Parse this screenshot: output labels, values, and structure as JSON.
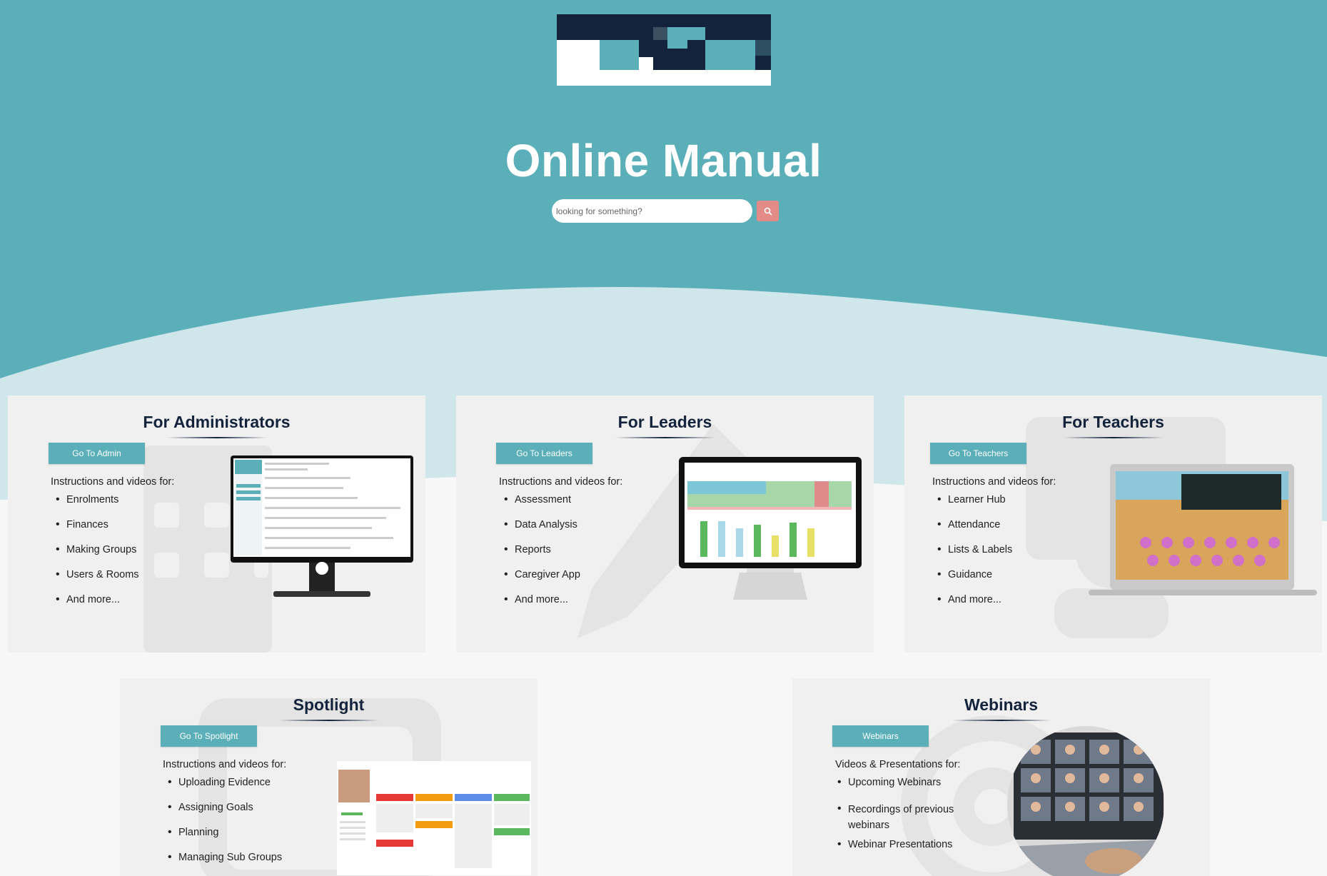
{
  "hero": {
    "title": "Online Manual",
    "search_placeholder": "looking for something?",
    "search_icon": "search-icon"
  },
  "colors": {
    "teal": "#5aafb8",
    "light_wave": "#cfe6ea",
    "navy": "#14233c",
    "search_button": "#e38b87",
    "card_bg": "#f0f0f0"
  },
  "cards": {
    "admin": {
      "title": "For Administrators",
      "button": "Go To Admin",
      "intro": "Instructions and videos for:",
      "items": [
        "Enrolments",
        "Finances",
        "Making Groups",
        "Users & Rooms",
        "And more..."
      ]
    },
    "leaders": {
      "title": "For Leaders",
      "button": "Go To Leaders",
      "intro": "Instructions and videos for:",
      "items": [
        "Assessment",
        "Data Analysis",
        "Reports",
        "Caregiver App",
        "And more..."
      ]
    },
    "teachers": {
      "title": "For Teachers",
      "button": "Go To Teachers",
      "intro": "Instructions and videos for:",
      "items": [
        "Learner Hub",
        "Attendance",
        "Lists & Labels",
        "Guidance",
        "And more..."
      ]
    },
    "spotlight": {
      "title": "Spotlight",
      "button": "Go To Spotlight",
      "intro": "Instructions and videos for:",
      "items": [
        "Uploading Evidence",
        "Assigning Goals",
        "Planning",
        "Managing Sub Groups"
      ]
    },
    "webinars": {
      "title": "Webinars",
      "button": "Webinars",
      "intro": "Videos & Presentations for:",
      "items": [
        "Upcoming Webinars",
        "Recordings of previous webinars",
        "Webinar Presentations"
      ]
    }
  }
}
